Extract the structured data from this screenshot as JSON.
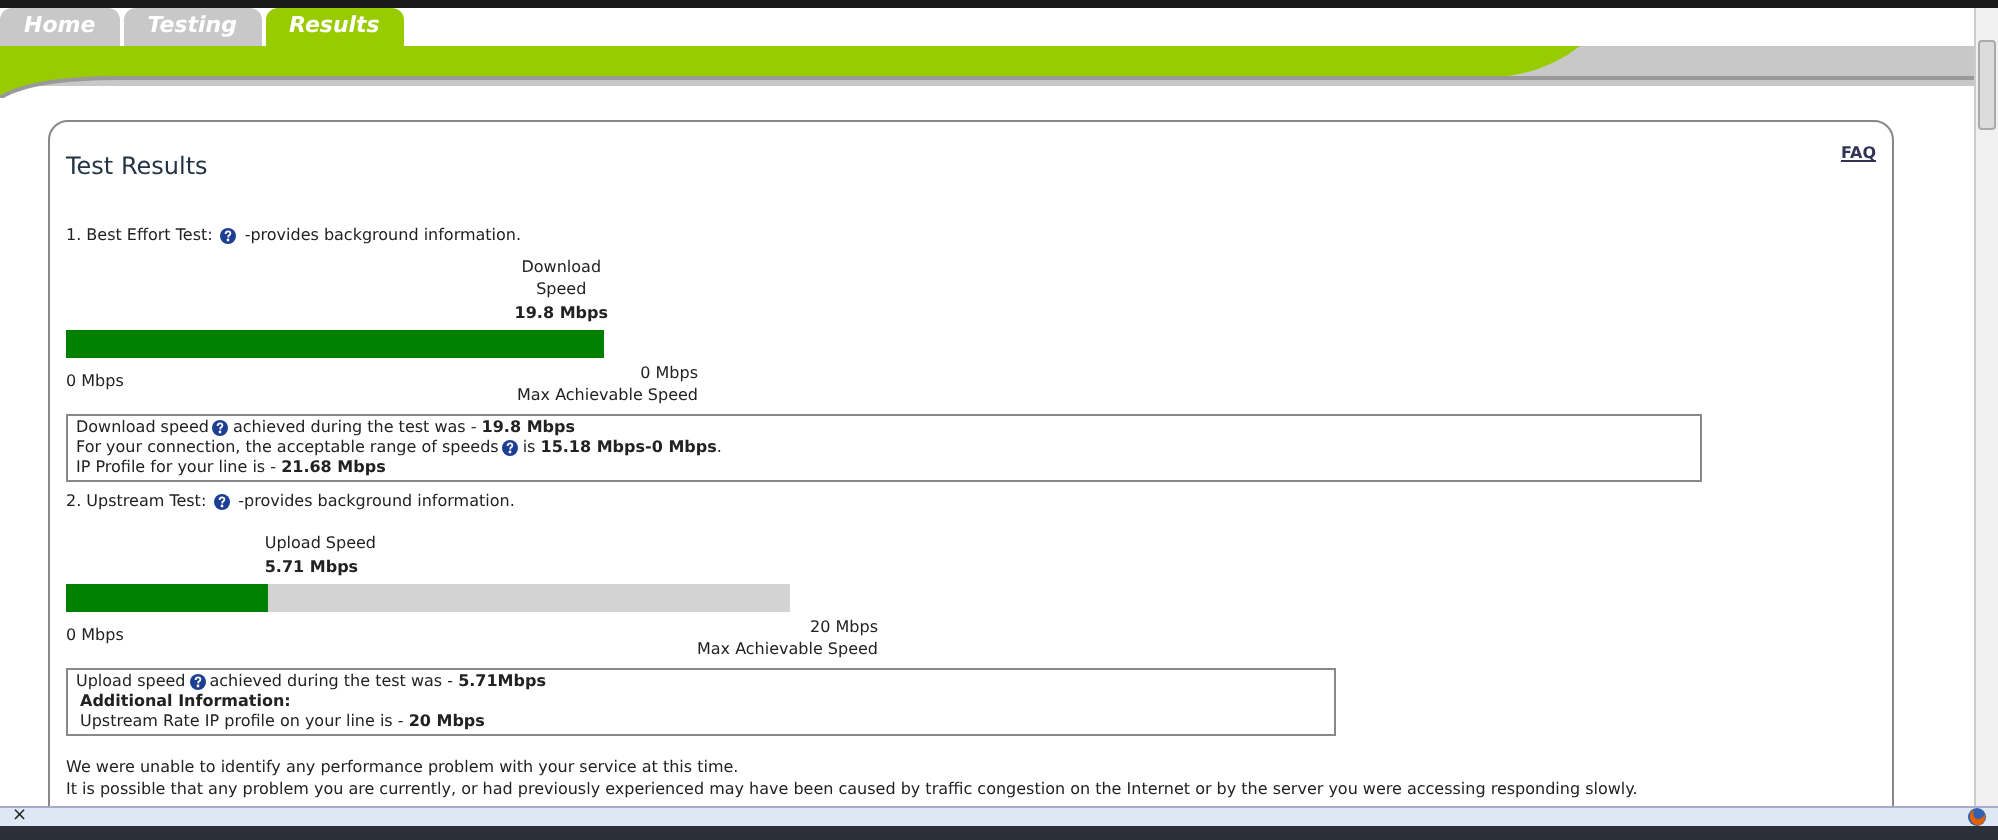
{
  "tabs": [
    {
      "label": "Home",
      "selected": false
    },
    {
      "label": "Testing",
      "selected": false
    },
    {
      "label": "Results",
      "selected": true
    }
  ],
  "card": {
    "title": "Test Results",
    "faq_link": "FAQ"
  },
  "tests": [
    {
      "heading": "1. Best Effort Test:",
      "heading_suffix": "-provides background information.",
      "speed_label": "Download Speed",
      "speed_value": "19.8 Mbps",
      "level": 1,
      "min_label": "0 Mbps",
      "max_value": "0 Mbps",
      "max_label": "Max Achievable Speed",
      "info_lines": [
        {
          "text": "Download speed",
          "after_help": "achieved during the test was - **19.8 Mbps**"
        },
        {
          "text": "For your connection, the acceptable range of speeds",
          "after_help": "is **15.18 Mbps-0 Mbps**."
        },
        {
          "text": "IP Profile for your line is - **21.68 Mbps**"
        }
      ]
    },
    {
      "heading": "2. Upstream Test:",
      "heading_suffix": "-provides background information.",
      "speed_label": "Upload Speed",
      "speed_value": "5.71 Mbps",
      "level": 0.28,
      "min_label": "0 Mbps",
      "max_value": "20 Mbps",
      "max_label": "Max Achievable Speed",
      "info_lines": [
        {
          "text": "Upload speed",
          "after_help": "achieved during the test was - **5.71Mbps**"
        },
        {
          "text": "**Additional Information:**"
        },
        {
          "text": "Upstream Rate IP profile on your line is - **20 Mbps**"
        }
      ]
    }
  ],
  "summary": [
    "We were unable to identify any performance problem with your service at this time.",
    "It is possible that any problem you are currently, or had previously experienced may have been caused by traffic congestion on the Internet or by the server you were accessing responding slowly."
  ],
  "status_bar": {
    "close": "×"
  }
}
